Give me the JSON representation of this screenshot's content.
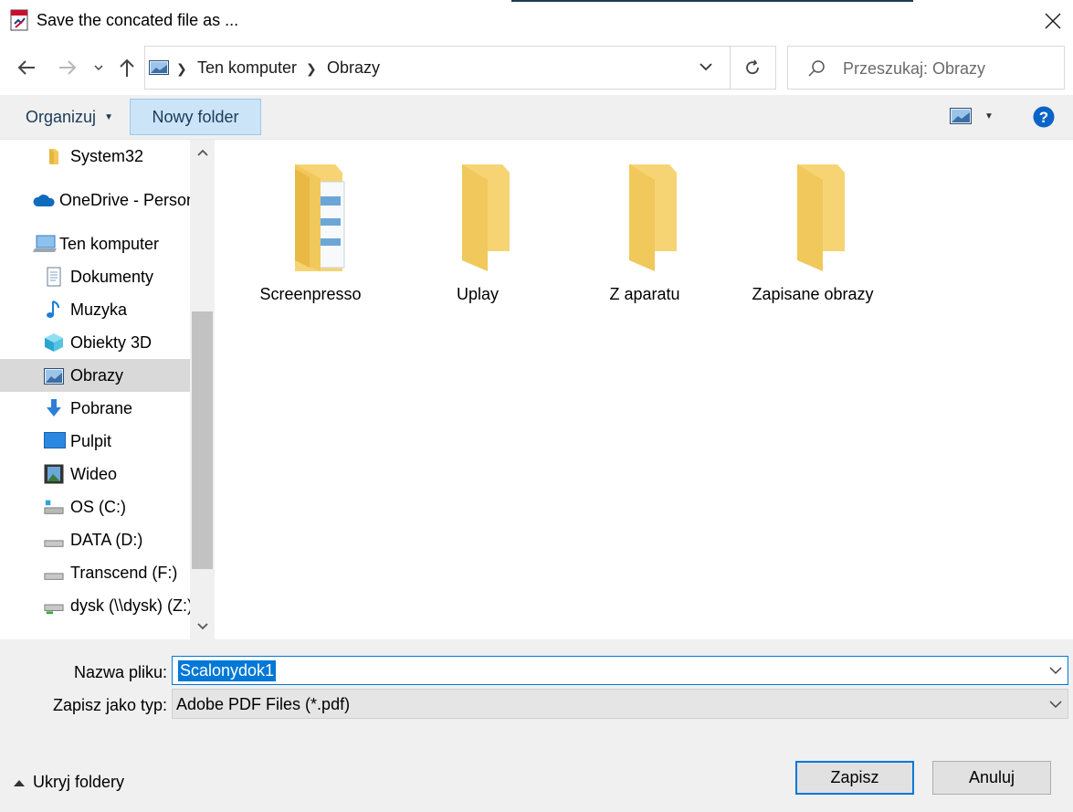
{
  "window": {
    "title": "Save the concated file as ...",
    "accent": "#0078d7"
  },
  "address": {
    "crumbs": [
      "Ten komputer",
      "Obrazy"
    ]
  },
  "search": {
    "placeholder": "Przeszukaj: Obrazy"
  },
  "toolbar": {
    "organize_label": "Organizuj",
    "new_folder_label": "Nowy folder"
  },
  "sidebar": {
    "items": [
      {
        "label": "System32",
        "icon": "folder-icon"
      },
      {
        "label": "OneDrive - Person",
        "icon": "cloud-icon"
      },
      {
        "label": "Ten komputer",
        "icon": "computer-icon"
      },
      {
        "label": "Dokumenty",
        "icon": "document-icon"
      },
      {
        "label": "Muzyka",
        "icon": "music-icon"
      },
      {
        "label": "Obiekty 3D",
        "icon": "cube-icon"
      },
      {
        "label": "Obrazy",
        "icon": "pictures-icon",
        "selected": true
      },
      {
        "label": "Pobrane",
        "icon": "download-icon"
      },
      {
        "label": "Pulpit",
        "icon": "desktop-icon"
      },
      {
        "label": "Wideo",
        "icon": "video-icon"
      },
      {
        "label": "OS (C:)",
        "icon": "drive-icon"
      },
      {
        "label": "DATA (D:)",
        "icon": "drive-icon"
      },
      {
        "label": "Transcend (F:)",
        "icon": "drive-icon"
      },
      {
        "label": "dysk (\\\\dysk) (Z:)",
        "icon": "network-drive-icon"
      }
    ]
  },
  "folders": [
    {
      "label": "Screenpresso"
    },
    {
      "label": "Uplay"
    },
    {
      "label": "Z aparatu"
    },
    {
      "label": "Zapisane obrazy"
    }
  ],
  "form": {
    "filename_label": "Nazwa pliku:",
    "filename_value": "Scalonydok1",
    "filetype_label": "Zapisz jako typ:",
    "filetype_value": "Adobe PDF Files (*.pdf)"
  },
  "footer": {
    "hide_folders_label": "Ukryj foldery",
    "save_label": "Zapisz",
    "cancel_label": "Anuluj"
  }
}
